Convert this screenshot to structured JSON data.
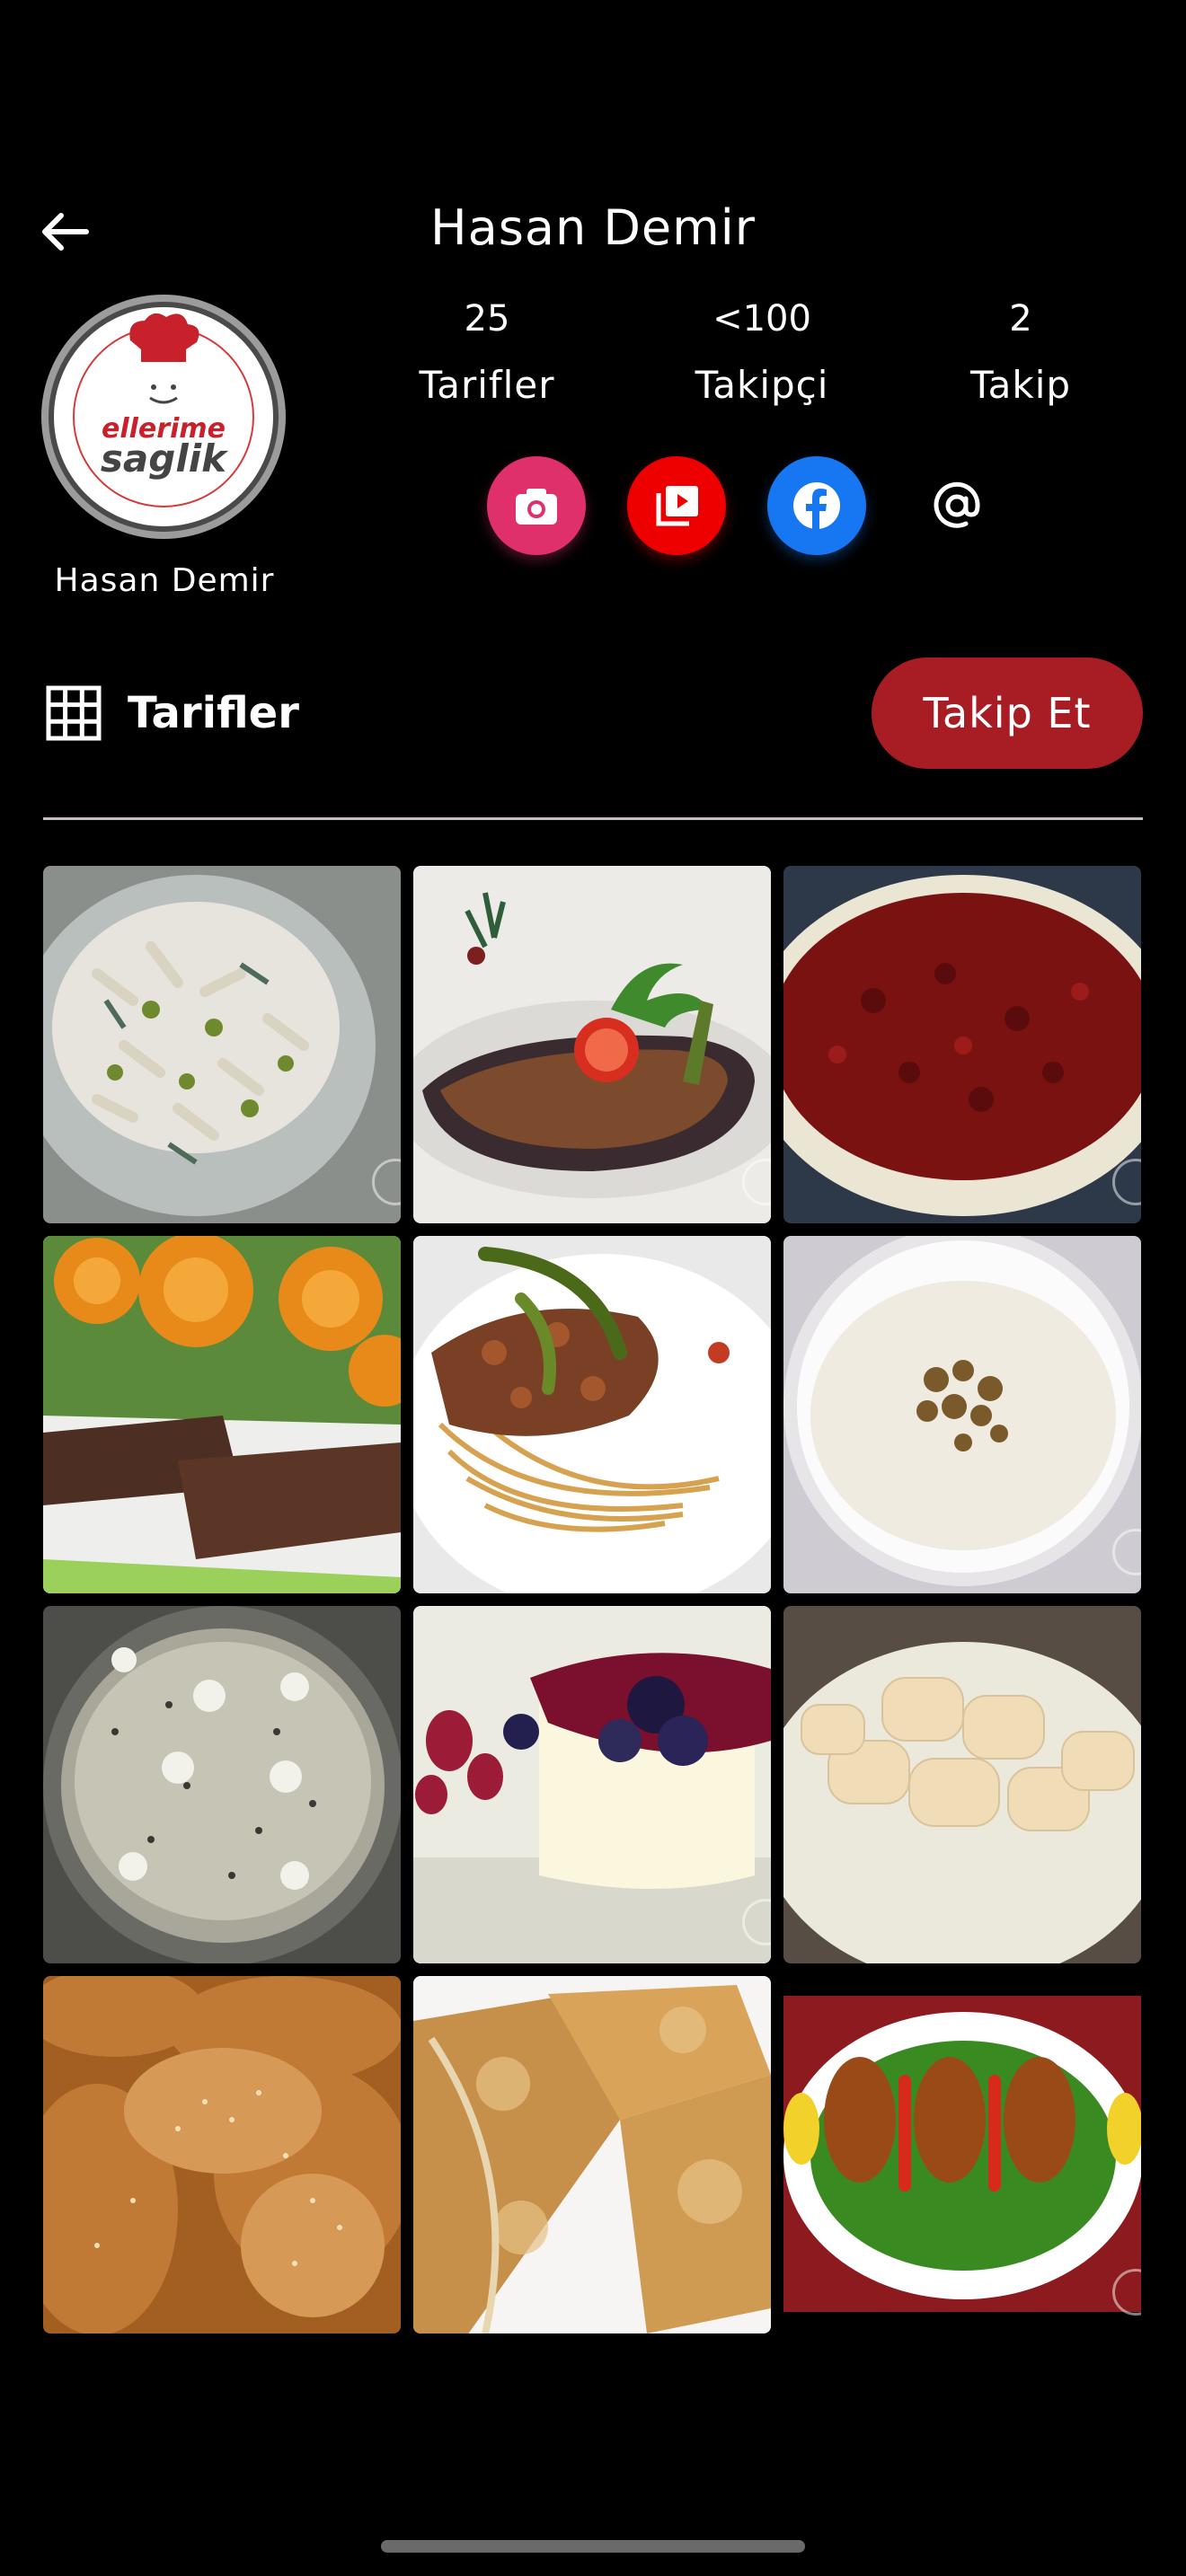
{
  "header": {
    "title": "Hasan Demir"
  },
  "profile": {
    "name": "Hasan Demir",
    "avatar_text_top": "ellerime",
    "avatar_text_bottom": "saglik"
  },
  "stats": [
    {
      "value": "25",
      "label": "Tarifler"
    },
    {
      "value": "<100",
      "label": "Takipçi"
    },
    {
      "value": "2",
      "label": "Takip"
    }
  ],
  "social": [
    {
      "icon": "camera-icon",
      "color": "#e0306c"
    },
    {
      "icon": "video-library-icon",
      "color": "#ee0000"
    },
    {
      "icon": "facebook-icon",
      "color": "#1777f2"
    },
    {
      "icon": "at-sign-icon",
      "color": "#ffffff"
    }
  ],
  "section": {
    "label": "Tarifler",
    "icon": "grid-icon"
  },
  "follow_button": {
    "label": "Takip Et",
    "color": "#a81d23"
  },
  "recipes": [
    {
      "name": "pasta-salad"
    },
    {
      "name": "stuffed-eggplant"
    },
    {
      "name": "red-pepper-paste"
    },
    {
      "name": "chocolate-bars"
    },
    {
      "name": "spaghetti-bolognese"
    },
    {
      "name": "walnut-pudding"
    },
    {
      "name": "cake"
    },
    {
      "name": "panna-cotta"
    },
    {
      "name": "cookies"
    },
    {
      "name": "sesame-pastry"
    },
    {
      "name": "rolled-borek"
    },
    {
      "name": "icli-kofte"
    }
  ]
}
